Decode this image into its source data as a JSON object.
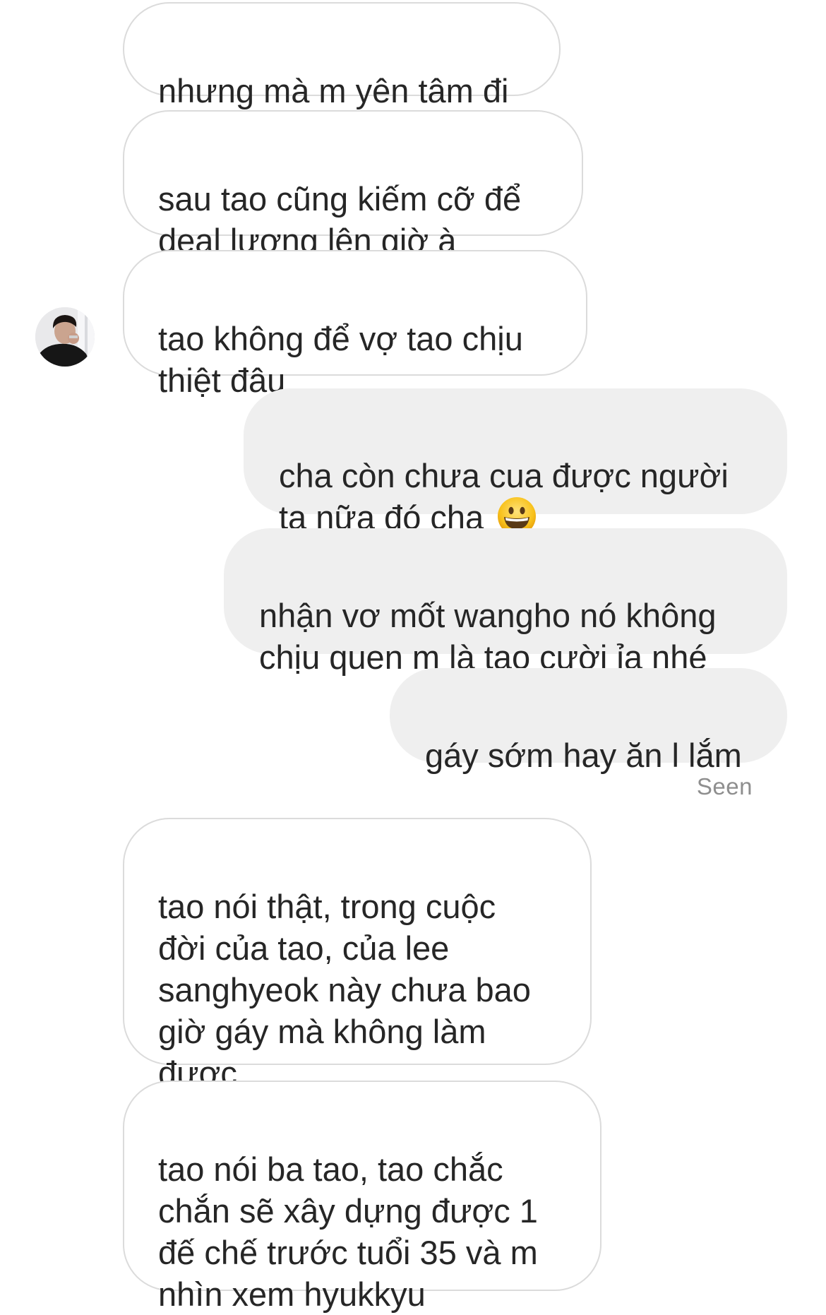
{
  "messages": [
    {
      "id": "m1",
      "direction": "incoming",
      "text": "nhưng mà m yên tâm đi"
    },
    {
      "id": "m2",
      "direction": "incoming",
      "text": "sau tao cũng kiếm cỡ để\ndeal lương lên giờ à"
    },
    {
      "id": "m3",
      "direction": "incoming",
      "text": "tao không để vợ tao chịu\nthiệt đâu"
    },
    {
      "id": "m4",
      "direction": "outgoing",
      "text": "cha còn chưa cua được người\nta nữa đó cha ",
      "emoji": "grinning-face-emoji"
    },
    {
      "id": "m5",
      "direction": "outgoing",
      "text": "nhận vơ mốt wangho nó không\nchịu quen m là tao cười ỉa nhé"
    },
    {
      "id": "m6",
      "direction": "outgoing",
      "text": "gáy sớm hay ăn l lắm"
    },
    {
      "id": "m7",
      "direction": "incoming",
      "text": "tao nói thật, trong cuộc\nđời của tao, của lee\nsanghyeok này chưa bao\ngiờ gáy mà không làm\nđược"
    },
    {
      "id": "m8",
      "direction": "incoming",
      "text": "tao nói ba tao, tao chắc\nchắn sẽ xây dựng được 1\nđế chế trước tuổi 35 và m\nnhìn xem hyukkyu"
    }
  ],
  "read_receipt": "Seen",
  "colors": {
    "incoming_bubble_bg": "#ffffff",
    "incoming_bubble_border": "#dbdbdb",
    "outgoing_bubble_bg": "#efefef",
    "text": "#262626",
    "seen_text": "#8e8e8e"
  }
}
